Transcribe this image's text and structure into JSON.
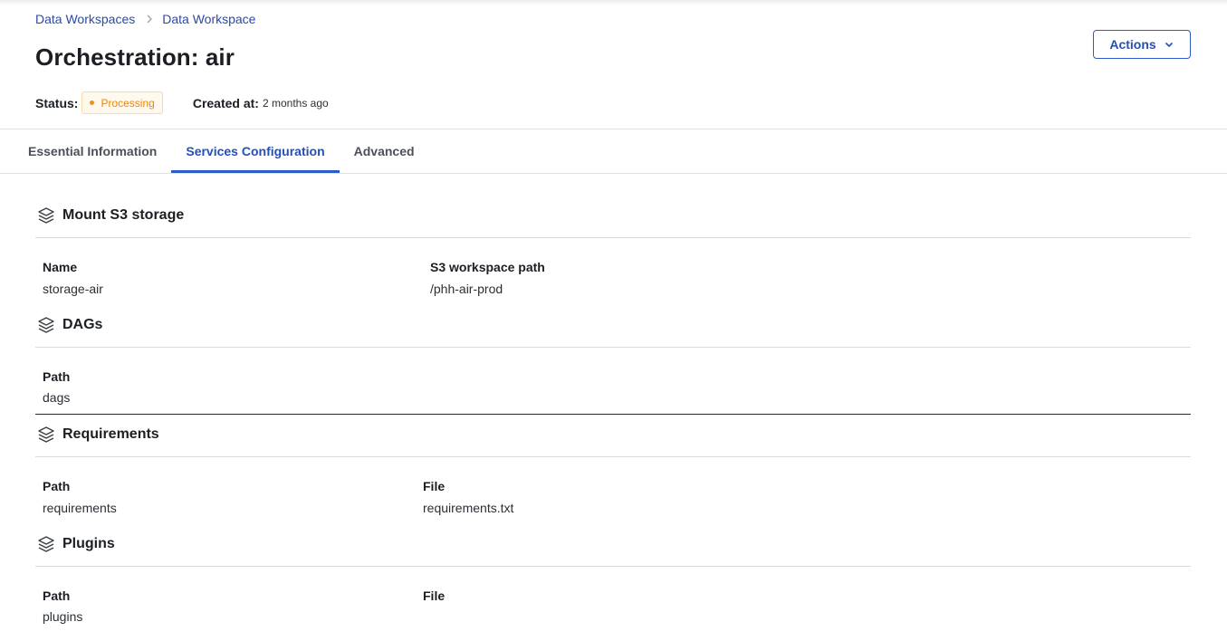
{
  "breadcrumb": {
    "items": [
      "Data Workspaces",
      "Data Workspace"
    ]
  },
  "header": {
    "title": "Orchestration: air",
    "actions_label": "Actions",
    "status_label": "Status:",
    "status_value": "Processing",
    "created_label": "Created at:",
    "created_value": "2 months ago"
  },
  "tabs": [
    {
      "label": "Essential Information",
      "active": false
    },
    {
      "label": "Services Configuration",
      "active": true
    },
    {
      "label": "Advanced",
      "active": false
    }
  ],
  "sections": [
    {
      "title": "Mount S3 storage",
      "fields": [
        {
          "label": "Name",
          "value": "storage-air"
        },
        {
          "label": "S3 workspace path",
          "value": "/phh-air-prod"
        }
      ]
    },
    {
      "title": "DAGs",
      "fields": [
        {
          "label": "Path",
          "value": "dags"
        }
      ]
    },
    {
      "title": "Requirements",
      "fields": [
        {
          "label": "Path",
          "value": "requirements"
        },
        {
          "label": "File",
          "value": "requirements.txt"
        }
      ]
    },
    {
      "title": "Plugins",
      "fields": [
        {
          "label": "Path",
          "value": "plugins"
        },
        {
          "label": "File",
          "value": ""
        }
      ]
    }
  ],
  "icons": {
    "section": "layers-icon",
    "chevron": "chevron-down-icon",
    "breadcrumb_sep": "chevron-right-icon"
  },
  "colors": {
    "accent": "#2b5cc8",
    "status": "#e8890c"
  }
}
